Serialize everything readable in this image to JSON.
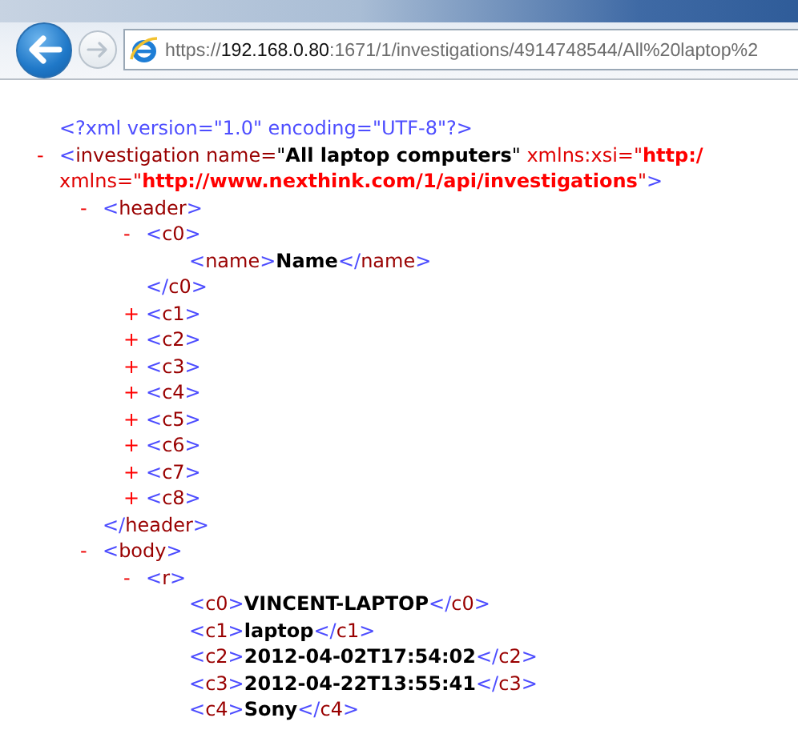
{
  "browser": {
    "address": {
      "scheme": "https://",
      "host": "192.168.0.80",
      "path": ":1671/1/investigations/4914748544/All%20laptop%2"
    }
  },
  "document": [
    {
      "segments": [
        {
          "kind": "pi",
          "text": "<?xml version=\"1.0\" encoding=\"UTF-8\"?>"
        }
      ]
    },
    {
      "toggle": "-",
      "expanded": true,
      "segments": [
        {
          "kind": "bracket",
          "text": "<"
        },
        {
          "kind": "tag",
          "text": "investigation"
        },
        {
          "kind": "attr",
          "text": " name="
        },
        {
          "kind": "quote",
          "text": "\""
        },
        {
          "kind": "value",
          "text": "All laptop computers"
        },
        {
          "kind": "quote",
          "text": "\""
        },
        {
          "kind": "ns-attr",
          "text": " xmlns:xsi="
        },
        {
          "kind": "ns-quote",
          "text": "\""
        },
        {
          "kind": "ns-value",
          "text": "http:/"
        },
        {
          "kind": "ns-attr",
          "text": " xmlns="
        },
        {
          "kind": "ns-quote",
          "text": "\""
        },
        {
          "kind": "ns-value",
          "text": "http://www.nexthink.com/1/api/investigations"
        },
        {
          "kind": "ns-quote",
          "text": "\""
        },
        {
          "kind": "bracket",
          "text": ">"
        }
      ],
      "children": [
        {
          "toggle": "-",
          "expanded": true,
          "segments": [
            {
              "kind": "bracket",
              "text": "<"
            },
            {
              "kind": "tag",
              "text": "header"
            },
            {
              "kind": "bracket",
              "text": ">"
            }
          ],
          "children": [
            {
              "toggle": "-",
              "expanded": true,
              "segments": [
                {
                  "kind": "bracket",
                  "text": "<"
                },
                {
                  "kind": "tag",
                  "text": "c0"
                },
                {
                  "kind": "bracket",
                  "text": ">"
                }
              ],
              "children": [
                {
                  "segments": [
                    {
                      "kind": "bracket",
                      "text": "<"
                    },
                    {
                      "kind": "tag",
                      "text": "name"
                    },
                    {
                      "kind": "bracket",
                      "text": ">"
                    },
                    {
                      "kind": "text",
                      "text": "Name"
                    },
                    {
                      "kind": "bracket",
                      "text": "</"
                    },
                    {
                      "kind": "tag",
                      "text": "name"
                    },
                    {
                      "kind": "bracket",
                      "text": ">"
                    }
                  ]
                }
              ],
              "end_segments": [
                {
                  "kind": "bracket",
                  "text": "</"
                },
                {
                  "kind": "tag",
                  "text": "c0"
                },
                {
                  "kind": "bracket",
                  "text": ">"
                }
              ]
            },
            {
              "toggle": "+",
              "expanded": false,
              "segments": [
                {
                  "kind": "bracket",
                  "text": "<"
                },
                {
                  "kind": "tag",
                  "text": "c1"
                },
                {
                  "kind": "bracket",
                  "text": ">"
                }
              ]
            },
            {
              "toggle": "+",
              "expanded": false,
              "segments": [
                {
                  "kind": "bracket",
                  "text": "<"
                },
                {
                  "kind": "tag",
                  "text": "c2"
                },
                {
                  "kind": "bracket",
                  "text": ">"
                }
              ]
            },
            {
              "toggle": "+",
              "expanded": false,
              "segments": [
                {
                  "kind": "bracket",
                  "text": "<"
                },
                {
                  "kind": "tag",
                  "text": "c3"
                },
                {
                  "kind": "bracket",
                  "text": ">"
                }
              ]
            },
            {
              "toggle": "+",
              "expanded": false,
              "segments": [
                {
                  "kind": "bracket",
                  "text": "<"
                },
                {
                  "kind": "tag",
                  "text": "c4"
                },
                {
                  "kind": "bracket",
                  "text": ">"
                }
              ]
            },
            {
              "toggle": "+",
              "expanded": false,
              "segments": [
                {
                  "kind": "bracket",
                  "text": "<"
                },
                {
                  "kind": "tag",
                  "text": "c5"
                },
                {
                  "kind": "bracket",
                  "text": ">"
                }
              ]
            },
            {
              "toggle": "+",
              "expanded": false,
              "segments": [
                {
                  "kind": "bracket",
                  "text": "<"
                },
                {
                  "kind": "tag",
                  "text": "c6"
                },
                {
                  "kind": "bracket",
                  "text": ">"
                }
              ]
            },
            {
              "toggle": "+",
              "expanded": false,
              "segments": [
                {
                  "kind": "bracket",
                  "text": "<"
                },
                {
                  "kind": "tag",
                  "text": "c7"
                },
                {
                  "kind": "bracket",
                  "text": ">"
                }
              ]
            },
            {
              "toggle": "+",
              "expanded": false,
              "segments": [
                {
                  "kind": "bracket",
                  "text": "<"
                },
                {
                  "kind": "tag",
                  "text": "c8"
                },
                {
                  "kind": "bracket",
                  "text": ">"
                }
              ]
            }
          ],
          "end_segments": [
            {
              "kind": "bracket",
              "text": "</"
            },
            {
              "kind": "tag",
              "text": "header"
            },
            {
              "kind": "bracket",
              "text": ">"
            }
          ]
        },
        {
          "toggle": "-",
          "expanded": true,
          "segments": [
            {
              "kind": "bracket",
              "text": "<"
            },
            {
              "kind": "tag",
              "text": "body"
            },
            {
              "kind": "bracket",
              "text": ">"
            }
          ],
          "children": [
            {
              "toggle": "-",
              "expanded": true,
              "segments": [
                {
                  "kind": "bracket",
                  "text": "<"
                },
                {
                  "kind": "tag",
                  "text": "r"
                },
                {
                  "kind": "bracket",
                  "text": ">"
                }
              ],
              "children": [
                {
                  "segments": [
                    {
                      "kind": "bracket",
                      "text": "<"
                    },
                    {
                      "kind": "tag",
                      "text": "c0"
                    },
                    {
                      "kind": "bracket",
                      "text": ">"
                    },
                    {
                      "kind": "text",
                      "text": "VINCENT-LAPTOP"
                    },
                    {
                      "kind": "bracket",
                      "text": "</"
                    },
                    {
                      "kind": "tag",
                      "text": "c0"
                    },
                    {
                      "kind": "bracket",
                      "text": ">"
                    }
                  ]
                },
                {
                  "segments": [
                    {
                      "kind": "bracket",
                      "text": "<"
                    },
                    {
                      "kind": "tag",
                      "text": "c1"
                    },
                    {
                      "kind": "bracket",
                      "text": ">"
                    },
                    {
                      "kind": "text",
                      "text": "laptop"
                    },
                    {
                      "kind": "bracket",
                      "text": "</"
                    },
                    {
                      "kind": "tag",
                      "text": "c1"
                    },
                    {
                      "kind": "bracket",
                      "text": ">"
                    }
                  ]
                },
                {
                  "segments": [
                    {
                      "kind": "bracket",
                      "text": "<"
                    },
                    {
                      "kind": "tag",
                      "text": "c2"
                    },
                    {
                      "kind": "bracket",
                      "text": ">"
                    },
                    {
                      "kind": "text",
                      "text": "2012-04-02T17:54:02"
                    },
                    {
                      "kind": "bracket",
                      "text": "</"
                    },
                    {
                      "kind": "tag",
                      "text": "c2"
                    },
                    {
                      "kind": "bracket",
                      "text": ">"
                    }
                  ]
                },
                {
                  "segments": [
                    {
                      "kind": "bracket",
                      "text": "<"
                    },
                    {
                      "kind": "tag",
                      "text": "c3"
                    },
                    {
                      "kind": "bracket",
                      "text": ">"
                    },
                    {
                      "kind": "text",
                      "text": "2012-04-22T13:55:41"
                    },
                    {
                      "kind": "bracket",
                      "text": "</"
                    },
                    {
                      "kind": "tag",
                      "text": "c3"
                    },
                    {
                      "kind": "bracket",
                      "text": ">"
                    }
                  ]
                },
                {
                  "segments": [
                    {
                      "kind": "bracket",
                      "text": "<"
                    },
                    {
                      "kind": "tag",
                      "text": "c4"
                    },
                    {
                      "kind": "bracket",
                      "text": ">"
                    },
                    {
                      "kind": "text",
                      "text": "Sony"
                    },
                    {
                      "kind": "bracket",
                      "text": "</"
                    },
                    {
                      "kind": "tag",
                      "text": "c4"
                    },
                    {
                      "kind": "bracket",
                      "text": ">"
                    }
                  ]
                }
              ]
            }
          ]
        }
      ]
    }
  ]
}
